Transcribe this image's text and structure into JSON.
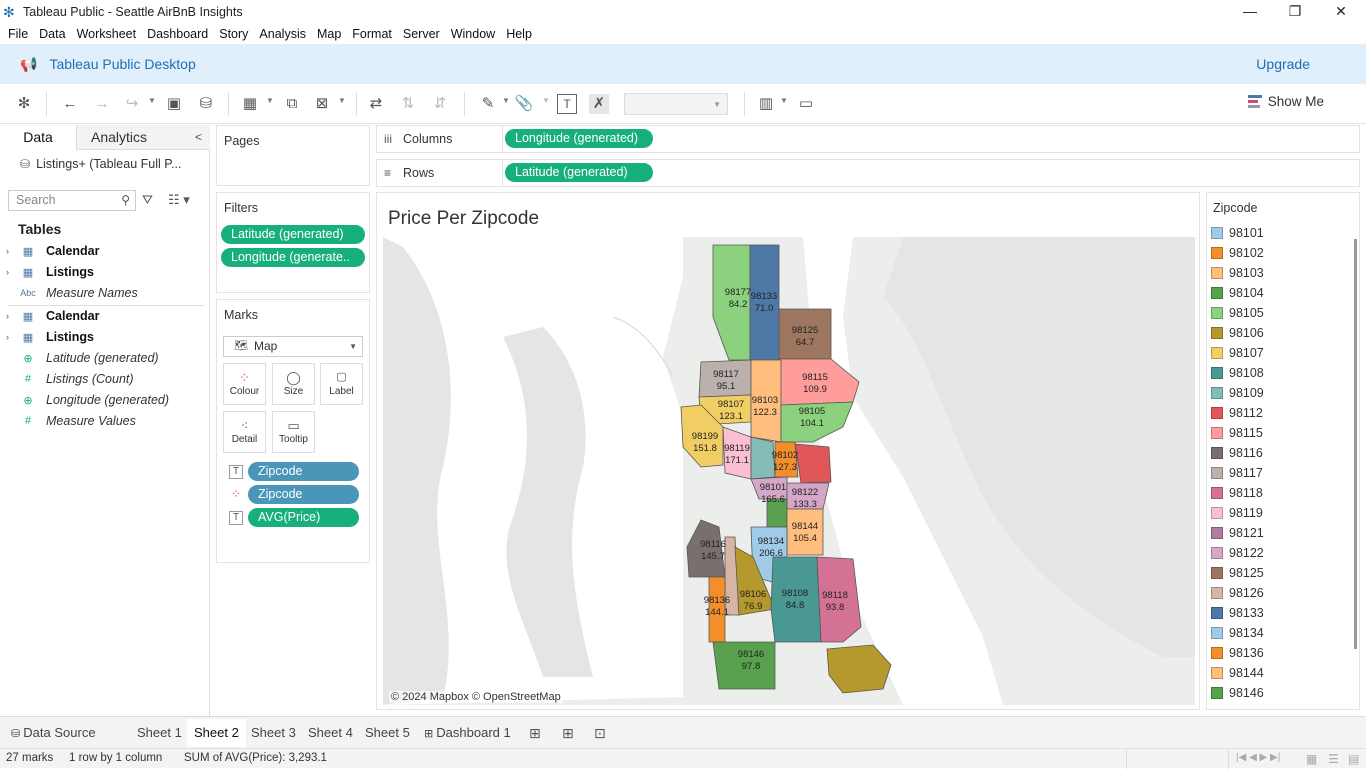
{
  "window": {
    "title": "Tableau Public - Seattle AirBnB Insights"
  },
  "menu": [
    "File",
    "Data",
    "Worksheet",
    "Dashboard",
    "Story",
    "Analysis",
    "Map",
    "Format",
    "Server",
    "Window",
    "Help"
  ],
  "banner": {
    "title": "Tableau Public Desktop",
    "upgrade": "Upgrade"
  },
  "toolbar": {
    "show_me": "Show Me"
  },
  "data_pane": {
    "tab_data": "Data",
    "tab_analytics": "Analytics",
    "datasource": "Listings+ (Tableau Full P...",
    "search_placeholder": "Search",
    "tables_heading": "Tables",
    "fields": [
      {
        "label": "Calendar",
        "type": "table"
      },
      {
        "label": "Listings",
        "type": "table"
      },
      {
        "label": "Measure Names",
        "type": "abc"
      },
      {
        "label": "Calendar",
        "type": "table"
      },
      {
        "label": "Listings",
        "type": "table"
      },
      {
        "label": "Latitude (generated)",
        "type": "geo"
      },
      {
        "label": "Listings (Count)",
        "type": "measure"
      },
      {
        "label": "Longitude (generated)",
        "type": "geo"
      },
      {
        "label": "Measure Values",
        "type": "measure"
      }
    ]
  },
  "pages": {
    "title": "Pages"
  },
  "filters": {
    "title": "Filters",
    "items": [
      "Latitude (generated)",
      "Longitude (generate.."
    ]
  },
  "marks": {
    "title": "Marks",
    "type": "Map",
    "buttons": [
      "Colour",
      "Size",
      "Label",
      "Detail",
      "Tooltip"
    ],
    "fields": [
      "Zipcode",
      "Zipcode",
      "AVG(Price)"
    ]
  },
  "shelves": {
    "columns_label": "Columns",
    "columns_pill": "Longitude (generated)",
    "rows_label": "Rows",
    "rows_pill": "Latitude (generated)"
  },
  "view": {
    "title": "Price Per Zipcode",
    "attribution": "© 2024 Mapbox © OpenStreetMap",
    "regions": [
      {
        "zip": "98177",
        "price": "84.2"
      },
      {
        "zip": "98133",
        "price": "71.0"
      },
      {
        "zip": "98125",
        "price": "64.7"
      },
      {
        "zip": "98117",
        "price": "95.1"
      },
      {
        "zip": "98115",
        "price": "109.9"
      },
      {
        "zip": "98107",
        "price": "123.1"
      },
      {
        "zip": "98103",
        "price": "122.3"
      },
      {
        "zip": "98105",
        "price": "104.1"
      },
      {
        "zip": "98199",
        "price": "151.8"
      },
      {
        "zip": "98119",
        "price": "171.1"
      },
      {
        "zip": "98102",
        "price": "127.3"
      },
      {
        "zip": "98101",
        "price": "165.6"
      },
      {
        "zip": "98122",
        "price": "133.3"
      },
      {
        "zip": "98144",
        "price": "105.4"
      },
      {
        "zip": "98116",
        "price": "145.7"
      },
      {
        "zip": "98134",
        "price": "206.6"
      },
      {
        "zip": "98106",
        "price": "76.9"
      },
      {
        "zip": "98108",
        "price": "84.8"
      },
      {
        "zip": "98118",
        "price": "93.8"
      },
      {
        "zip": "98136",
        "price": "144.1"
      },
      {
        "zip": "98146",
        "price": "97.8"
      }
    ]
  },
  "legend": {
    "title": "Zipcode",
    "items": [
      {
        "zip": "98101",
        "color": "#a0cbe8"
      },
      {
        "zip": "98102",
        "color": "#f28e2b"
      },
      {
        "zip": "98103",
        "color": "#ffbe7d"
      },
      {
        "zip": "98104",
        "color": "#59a14f"
      },
      {
        "zip": "98105",
        "color": "#8cd17d"
      },
      {
        "zip": "98106",
        "color": "#b6992d"
      },
      {
        "zip": "98107",
        "color": "#f1ce63"
      },
      {
        "zip": "98108",
        "color": "#499894"
      },
      {
        "zip": "98109",
        "color": "#86bcb6"
      },
      {
        "zip": "98112",
        "color": "#e15759"
      },
      {
        "zip": "98115",
        "color": "#ff9d9a"
      },
      {
        "zip": "98116",
        "color": "#79706e"
      },
      {
        "zip": "98117",
        "color": "#bab0ac"
      },
      {
        "zip": "98118",
        "color": "#d37295"
      },
      {
        "zip": "98119",
        "color": "#fabfd2"
      },
      {
        "zip": "98121",
        "color": "#b07aa1"
      },
      {
        "zip": "98122",
        "color": "#d4a6c8"
      },
      {
        "zip": "98125",
        "color": "#9d7660"
      },
      {
        "zip": "98126",
        "color": "#d7b5a6"
      },
      {
        "zip": "98133",
        "color": "#4e79a7"
      },
      {
        "zip": "98134",
        "color": "#a0cbe8"
      },
      {
        "zip": "98136",
        "color": "#f28e2b"
      },
      {
        "zip": "98144",
        "color": "#ffbe7d"
      },
      {
        "zip": "98146",
        "color": "#59a14f"
      }
    ]
  },
  "sheets": [
    "Data Source",
    "Sheet 1",
    "Sheet 2",
    "Sheet 3",
    "Sheet 4",
    "Sheet 5",
    "Dashboard 1"
  ],
  "active_sheet": "Sheet 2",
  "status": {
    "marks": "27 marks",
    "dims": "1 row by 1 column",
    "sum": "SUM of AVG(Price): 3,293.1"
  }
}
